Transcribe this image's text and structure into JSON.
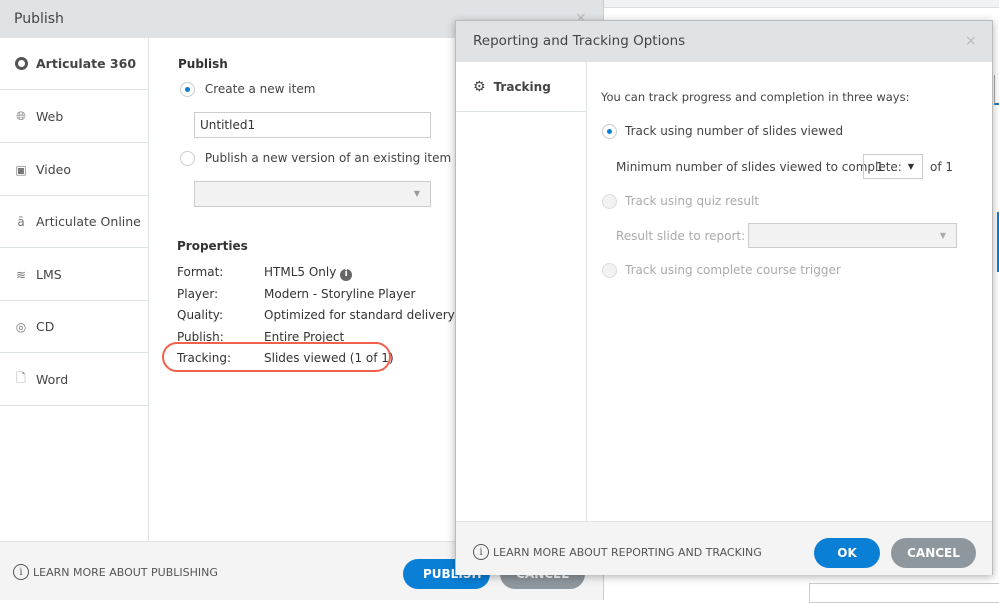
{
  "publish_dialog": {
    "title": "Publish",
    "close": "×",
    "sidebar": [
      {
        "label": "Articulate 360",
        "icon": "articulate-360-icon"
      },
      {
        "label": "Web",
        "icon": "globe-icon"
      },
      {
        "label": "Video",
        "icon": "video-icon"
      },
      {
        "label": "Articulate Online",
        "icon": "articulate-online-icon"
      },
      {
        "label": "LMS",
        "icon": "database-icon"
      },
      {
        "label": "CD",
        "icon": "cd-icon"
      },
      {
        "label": "Word",
        "icon": "word-icon"
      }
    ],
    "publish_heading": "Publish",
    "option_new": "Create a new item",
    "title_value": "Untitled1",
    "option_existing": "Publish a new version of an existing item",
    "properties_heading": "Properties",
    "properties": [
      {
        "key": "Format:",
        "value": "HTML5 Only"
      },
      {
        "key": "Player:",
        "value": "Modern - Storyline Player"
      },
      {
        "key": "Quality:",
        "value": "Optimized for standard delivery"
      },
      {
        "key": "Publish:",
        "value": "Entire Project"
      },
      {
        "key": "Tracking:",
        "value": "Slides viewed (1 of 1)"
      }
    ],
    "learn_more": "LEARN MORE ABOUT PUBLISHING",
    "publish_button": "PUBLISH",
    "cancel_button": "CANCEL"
  },
  "tracking_dialog": {
    "title": "Reporting and Tracking Options",
    "close": "×",
    "tab": "Tracking",
    "intro": "You can track progress and completion in three ways:",
    "opt_slides": "Track using number of slides viewed",
    "min_label": "Minimum number of slides viewed to complete:",
    "min_value": "1",
    "of_total": "of 1",
    "opt_quiz": "Track using quiz result",
    "result_label": "Result slide to report:",
    "opt_trigger": "Track using complete course trigger",
    "learn_more": "LEARN MORE ABOUT REPORTING AND TRACKING",
    "ok": "OK",
    "cancel": "CANCEL"
  },
  "colors": {
    "accent": "#0a7fd6",
    "annotation": "#f0604d",
    "cancel": "#8e979e"
  }
}
